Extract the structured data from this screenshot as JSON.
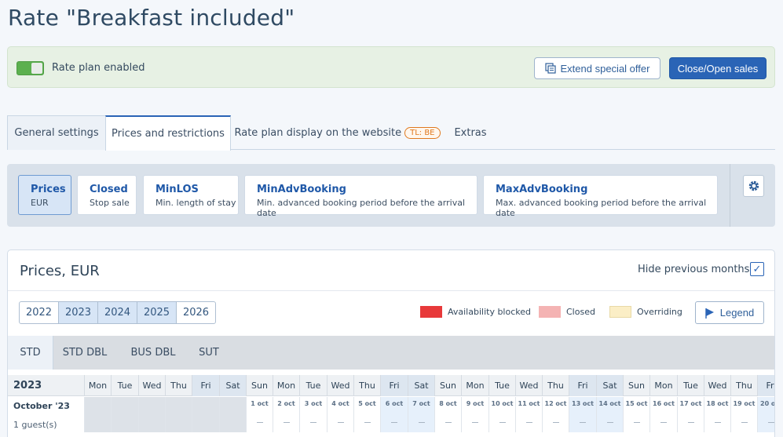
{
  "page": {
    "title": "Rate \"Breakfast included\""
  },
  "status_bar": {
    "toggle_label": "Rate plan enabled",
    "extend_label": "Extend special offer",
    "close_open_label": "Close/Open sales"
  },
  "tabs": [
    {
      "label": "General settings"
    },
    {
      "label": "Prices and restrictions"
    },
    {
      "label": "Rate plan display on the website",
      "badge": "TL: BE"
    },
    {
      "label": "Extras"
    }
  ],
  "filters": [
    {
      "title": "Prices",
      "sub": "EUR"
    },
    {
      "title": "Closed",
      "sub": "Stop sale"
    },
    {
      "title": "MinLOS",
      "sub": "Min. length of stay"
    },
    {
      "title": "MinAdvBooking",
      "sub": "Min. advanced booking period before the arrival date"
    },
    {
      "title": "MaxAdvBooking",
      "sub": "Max. advanced booking period before the arrival date"
    }
  ],
  "panel": {
    "title": "Prices, EUR",
    "hide_label": "Hide previous months",
    "hide_checked": true,
    "years": [
      "2022",
      "2023",
      "2024",
      "2025",
      "2026"
    ],
    "legend": [
      {
        "label": "Availability blocked",
        "color": "#e8393a"
      },
      {
        "label": "Closed",
        "color": "#f4b3b3"
      },
      {
        "label": "Overriding",
        "color": "#fbeec6"
      }
    ],
    "legend_button": "Legend"
  },
  "room_tabs": [
    "STD",
    "STD DBL",
    "BUS DBL",
    "SUT"
  ],
  "calendar": {
    "year": "2023",
    "month": "October '23",
    "guests": "1 guest(s)",
    "days": [
      "Mon",
      "Tue",
      "Wed",
      "Thu",
      "Fri",
      "Sat",
      "Sun",
      "Mon",
      "Tue",
      "Wed",
      "Thu",
      "Fri",
      "Sat",
      "Sun",
      "Mon",
      "Tue",
      "Wed",
      "Thu",
      "Fri",
      "Sat",
      "Sun",
      "Mon",
      "Tue",
      "Wed",
      "Thu",
      "Fri"
    ],
    "dates": [
      "",
      "",
      "",
      "",
      "",
      "",
      "1 oct",
      "2 oct",
      "3 oct",
      "4 oct",
      "5 oct",
      "6 oct",
      "7 oct",
      "8 oct",
      "9 oct",
      "10 oct",
      "11 oct",
      "12 oct",
      "13 oct",
      "14 oct",
      "15 oct",
      "16 oct",
      "17 oct",
      "18 oct",
      "19 oct",
      "20 oct"
    ]
  },
  "colors": {
    "accent": "#2a64b6",
    "toggle_on": "#5cb04f",
    "badge": "#e0791f"
  }
}
